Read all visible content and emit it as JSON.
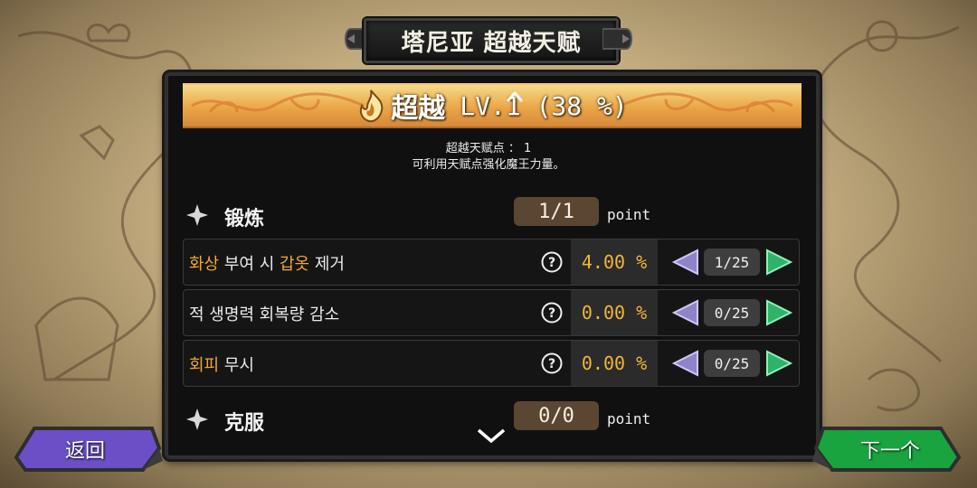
{
  "header": {
    "title": "塔尼亚 超越天赋"
  },
  "banner": {
    "title": "超越",
    "level": "LV.1 (38 %)",
    "icon": "flame-icon"
  },
  "description": {
    "line1": "超越天赋点 ： 1",
    "line2": "可利用天赋点强化魔王力量。"
  },
  "sections": [
    {
      "title": "锻炼",
      "points": "1/1",
      "points_label": "point"
    },
    {
      "title": "克服",
      "points": "0/0",
      "points_label": "point"
    }
  ],
  "talents": [
    {
      "parts": [
        {
          "text": "화상",
          "hl": true
        },
        {
          "text": " 부여 시 ",
          "hl": false
        },
        {
          "text": "갑옷",
          "hl": true
        },
        {
          "text": " 제거",
          "hl": false
        }
      ],
      "value": "4.00 %",
      "level": "1/25"
    },
    {
      "parts": [
        {
          "text": "적 생명력 회복량 감소",
          "hl": false
        },
        {
          "text": "",
          "hl": false
        },
        {
          "text": "",
          "hl": false
        },
        {
          "text": "",
          "hl": false
        }
      ],
      "value": "0.00 %",
      "level": "0/25"
    },
    {
      "parts": [
        {
          "text": "회피",
          "hl": true
        },
        {
          "text": " 무시",
          "hl": false
        },
        {
          "text": "",
          "hl": false
        },
        {
          "text": "",
          "hl": false
        }
      ],
      "value": "0.00 %",
      "level": "0/25"
    }
  ],
  "buttons": {
    "back": "返回",
    "next": "下一个"
  },
  "colors": {
    "highlight": "#f2a733",
    "value": "#f2b53a",
    "back_button": "#6a4fc6",
    "next_button": "#19a43f",
    "banner": "#eaa647"
  }
}
